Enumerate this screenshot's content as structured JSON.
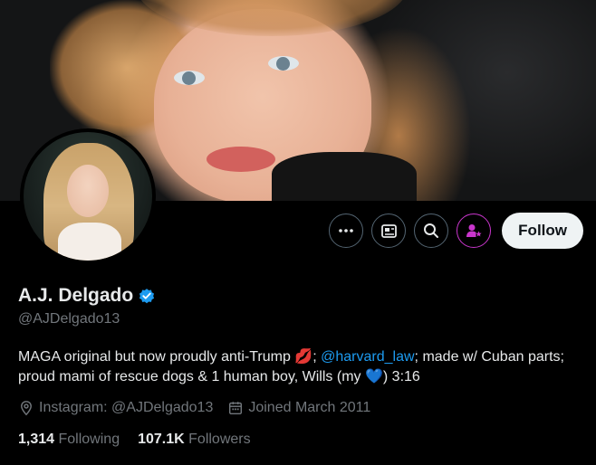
{
  "profile": {
    "name": "A.J. Delgado",
    "handle": "@AJDelgado13",
    "bio_part1": "MAGA original but now proudly anti-Trump ",
    "bio_emoji1": "💋",
    "bio_part2": "; ",
    "bio_link": "@harvard_law",
    "bio_part3": "; made w/ Cuban parts; proud mami of rescue dogs & 1 human boy, Wills (my ",
    "bio_emoji2": "💙",
    "bio_part4": ") 3:16",
    "location": "Instagram: @AJDelgado13",
    "joined": "Joined March 2011"
  },
  "stats": {
    "following_count": "1,314",
    "following_label": "Following",
    "followers_count": "107.1K",
    "followers_label": "Followers"
  },
  "actions": {
    "follow_label": "Follow",
    "icons": [
      "more-icon",
      "newsletter-icon",
      "search-icon",
      "subscribe-icon"
    ]
  },
  "colors": {
    "accent": "#1d9bf0",
    "verified": "#1d9bf0",
    "subscribe": "#c936cc",
    "background": "#000000",
    "secondary_text": "#71767b"
  }
}
